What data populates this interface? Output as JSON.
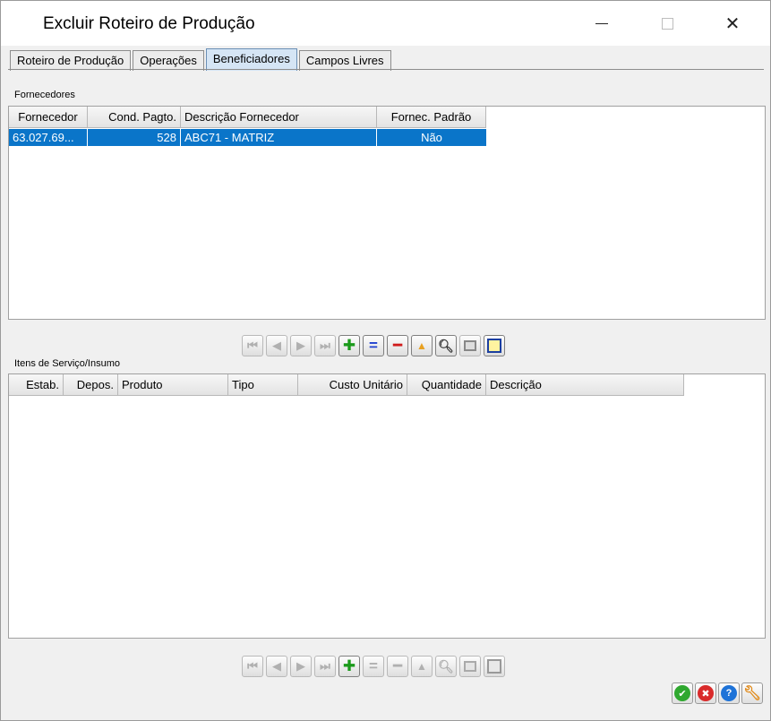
{
  "window": {
    "title": "Excluir Roteiro de Produção",
    "minimize_glyph": "",
    "close_glyph": "✕"
  },
  "tabs": [
    {
      "label": "Roteiro de Produção",
      "active": false
    },
    {
      "label": "Operações",
      "active": false
    },
    {
      "label": "Beneficiadores",
      "active": true
    },
    {
      "label": "Campos Livres",
      "active": false
    }
  ],
  "fornecedores": {
    "label": "Fornecedores",
    "columns": [
      "Fornecedor",
      "Cond. Pagto.",
      "Descrição Fornecedor",
      "Fornec. Padrão"
    ],
    "rows": [
      [
        "63.027.69...",
        "528",
        "ABC71 - MATRIZ",
        "Não"
      ]
    ],
    "selected_row_color": "#0a75c9"
  },
  "itens": {
    "label": "Itens de Serviço/Insumo",
    "columns": [
      "Estab.",
      "Depos.",
      "Produto",
      "Tipo",
      "Custo Unitário",
      "Quantidade",
      "Descrição"
    ]
  },
  "navigator_icons": [
    "first-icon",
    "prev-icon",
    "next-icon",
    "last-icon",
    "add-icon",
    "edit-icon",
    "delete-icon",
    "sort-icon",
    "search-icon",
    "grid-icon",
    "export-icon"
  ],
  "dialog_buttons": [
    "confirm-icon",
    "cancel-icon",
    "help-icon",
    "settings-icon"
  ],
  "colors": {
    "confirm": "#2fa82f",
    "cancel": "#d92b2b",
    "help": "#1e73d8",
    "settings": "#e08a1a"
  }
}
